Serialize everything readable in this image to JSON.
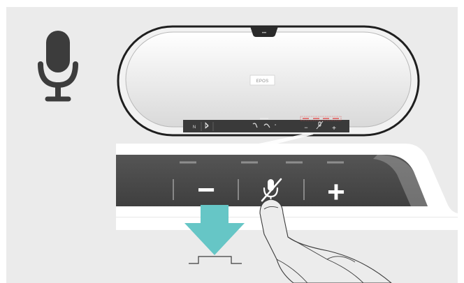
{
  "device": {
    "brand_label": "EPOS",
    "top_button_glyph": "•••",
    "small_panel": {
      "bluetooth_n_label": "N",
      "bluetooth_icon": "bluetooth-icon",
      "call_icon": "phone-icon",
      "reject_icon": "phone-reject-icon",
      "minus_glyph": "−",
      "mic_icon": "microphone-muted-icon",
      "plus_glyph": "+"
    }
  },
  "zoom_panel": {
    "volume_down_glyph": "−",
    "mute_icon": "microphone-muted-icon",
    "volume_up_glyph": "+"
  },
  "callout": {
    "icon": "microphone-icon",
    "action": "press-arrow-icon",
    "hand": "finger-press-icon"
  },
  "colors": {
    "background": "#ebebeb",
    "accent_arrow": "#66c6c6",
    "led_indicator": "#e04a4a",
    "panel_dark": "#4a4a4a",
    "icon_dark": "#3c3c3c"
  }
}
